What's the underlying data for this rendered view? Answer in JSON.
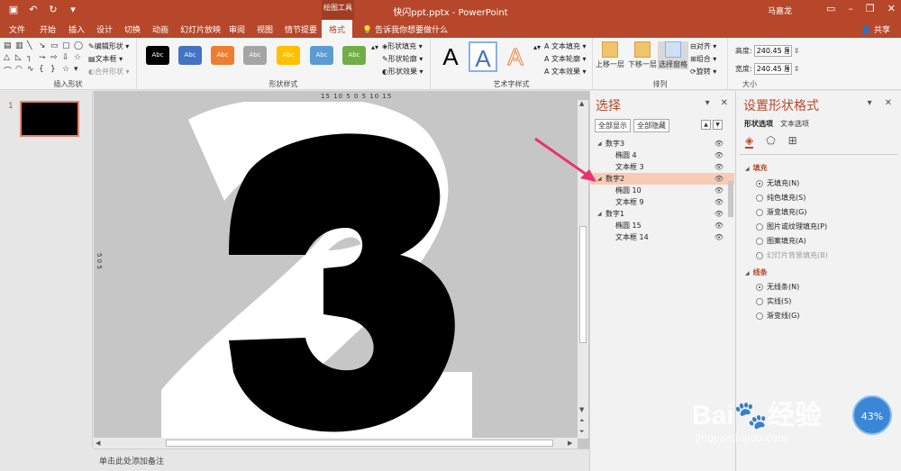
{
  "titlebar": {
    "context_tool": "绘图工具",
    "title": "快闪ppt.pptx - PowerPoint",
    "user": "马嘉龙",
    "qat_icons": [
      "save-icon",
      "undo-icon",
      "redo-icon",
      "customize-icon"
    ]
  },
  "tabs": [
    {
      "label": "文件"
    },
    {
      "label": "开始"
    },
    {
      "label": "插入"
    },
    {
      "label": "设计"
    },
    {
      "label": "切换"
    },
    {
      "label": "动画"
    },
    {
      "label": "幻灯片放映"
    },
    {
      "label": "审阅"
    },
    {
      "label": "视图"
    },
    {
      "label": "情节提要"
    },
    {
      "label": "格式",
      "active": true
    }
  ],
  "tell_me": "告诉我你想要做什么",
  "share": "共享",
  "ribbon": {
    "insert_shapes": {
      "label": "插入形状",
      "edit_shape": "编辑形状",
      "text_box": "文本框",
      "merge_shapes": "合并形状"
    },
    "shape_styles": {
      "label": "形状样式",
      "preset_text": "Abc",
      "presets": [
        "#000000",
        "#4472c4",
        "#ed7d31",
        "#a5a5a5",
        "#ffc000",
        "#5b9bd5",
        "#70ad47"
      ],
      "fill": "形状填充",
      "outline": "形状轮廓",
      "effects": "形状效果"
    },
    "wordart": {
      "label": "艺术字样式",
      "letter": "A",
      "text_fill": "文本填充",
      "text_outline": "文本轮廓",
      "text_effects": "文本效果"
    },
    "arrange": {
      "label": "排列",
      "bring_forward": "上移一层",
      "send_backward": "下移一层",
      "selection_pane": "选择窗格",
      "align": "对齐",
      "group": "组合",
      "rotate": "旋转"
    },
    "size": {
      "label": "大小",
      "height_label": "高度:",
      "height_value": "240.45 厘",
      "width_label": "宽度:",
      "width_value": "240.45 厘"
    }
  },
  "thumbnails": [
    {
      "number": "1"
    }
  ],
  "ruler_top": "15 10 5 0 5 10 15",
  "ruler_left": "5 0 5",
  "notes_placeholder": "单击此处添加备注",
  "selection_pane": {
    "title": "选择",
    "show_all": "全部显示",
    "hide_all": "全部隐藏",
    "items": [
      {
        "label": "数字3",
        "level": 0
      },
      {
        "label": "椭圆 4",
        "level": 1
      },
      {
        "label": "文本框 3",
        "level": 1
      },
      {
        "label": "数字2",
        "level": 0,
        "selected": true
      },
      {
        "label": "椭圆 10",
        "level": 1
      },
      {
        "label": "文本框 9",
        "level": 1
      },
      {
        "label": "数字1",
        "level": 0
      },
      {
        "label": "椭圆 15",
        "level": 1
      },
      {
        "label": "文本框 14",
        "level": 1
      }
    ]
  },
  "format_pane": {
    "title": "设置形状格式",
    "tab_shape": "形状选项",
    "tab_text": "文本选项",
    "fill_section": "填充",
    "fill_options": [
      {
        "label": "无填充(N)",
        "checked": true
      },
      {
        "label": "纯色填充(S)"
      },
      {
        "label": "渐变填充(G)"
      },
      {
        "label": "图片或纹理填充(P)"
      },
      {
        "label": "图案填充(A)"
      },
      {
        "label": "幻灯片背景填充(B)",
        "disabled": true
      }
    ],
    "line_section": "线条",
    "line_options": [
      {
        "label": "无线条(N)",
        "checked": true
      },
      {
        "label": "实线(S)"
      },
      {
        "label": "渐变线(G)"
      }
    ]
  },
  "watermark": {
    "brand": "Bai",
    "brand2": "经验",
    "url": "jingyan.baidu.com",
    "badge": "43%"
  },
  "colors": {
    "accent": "#b7472a",
    "selection": "#f8cbb4",
    "arrow": "#e8336f"
  }
}
